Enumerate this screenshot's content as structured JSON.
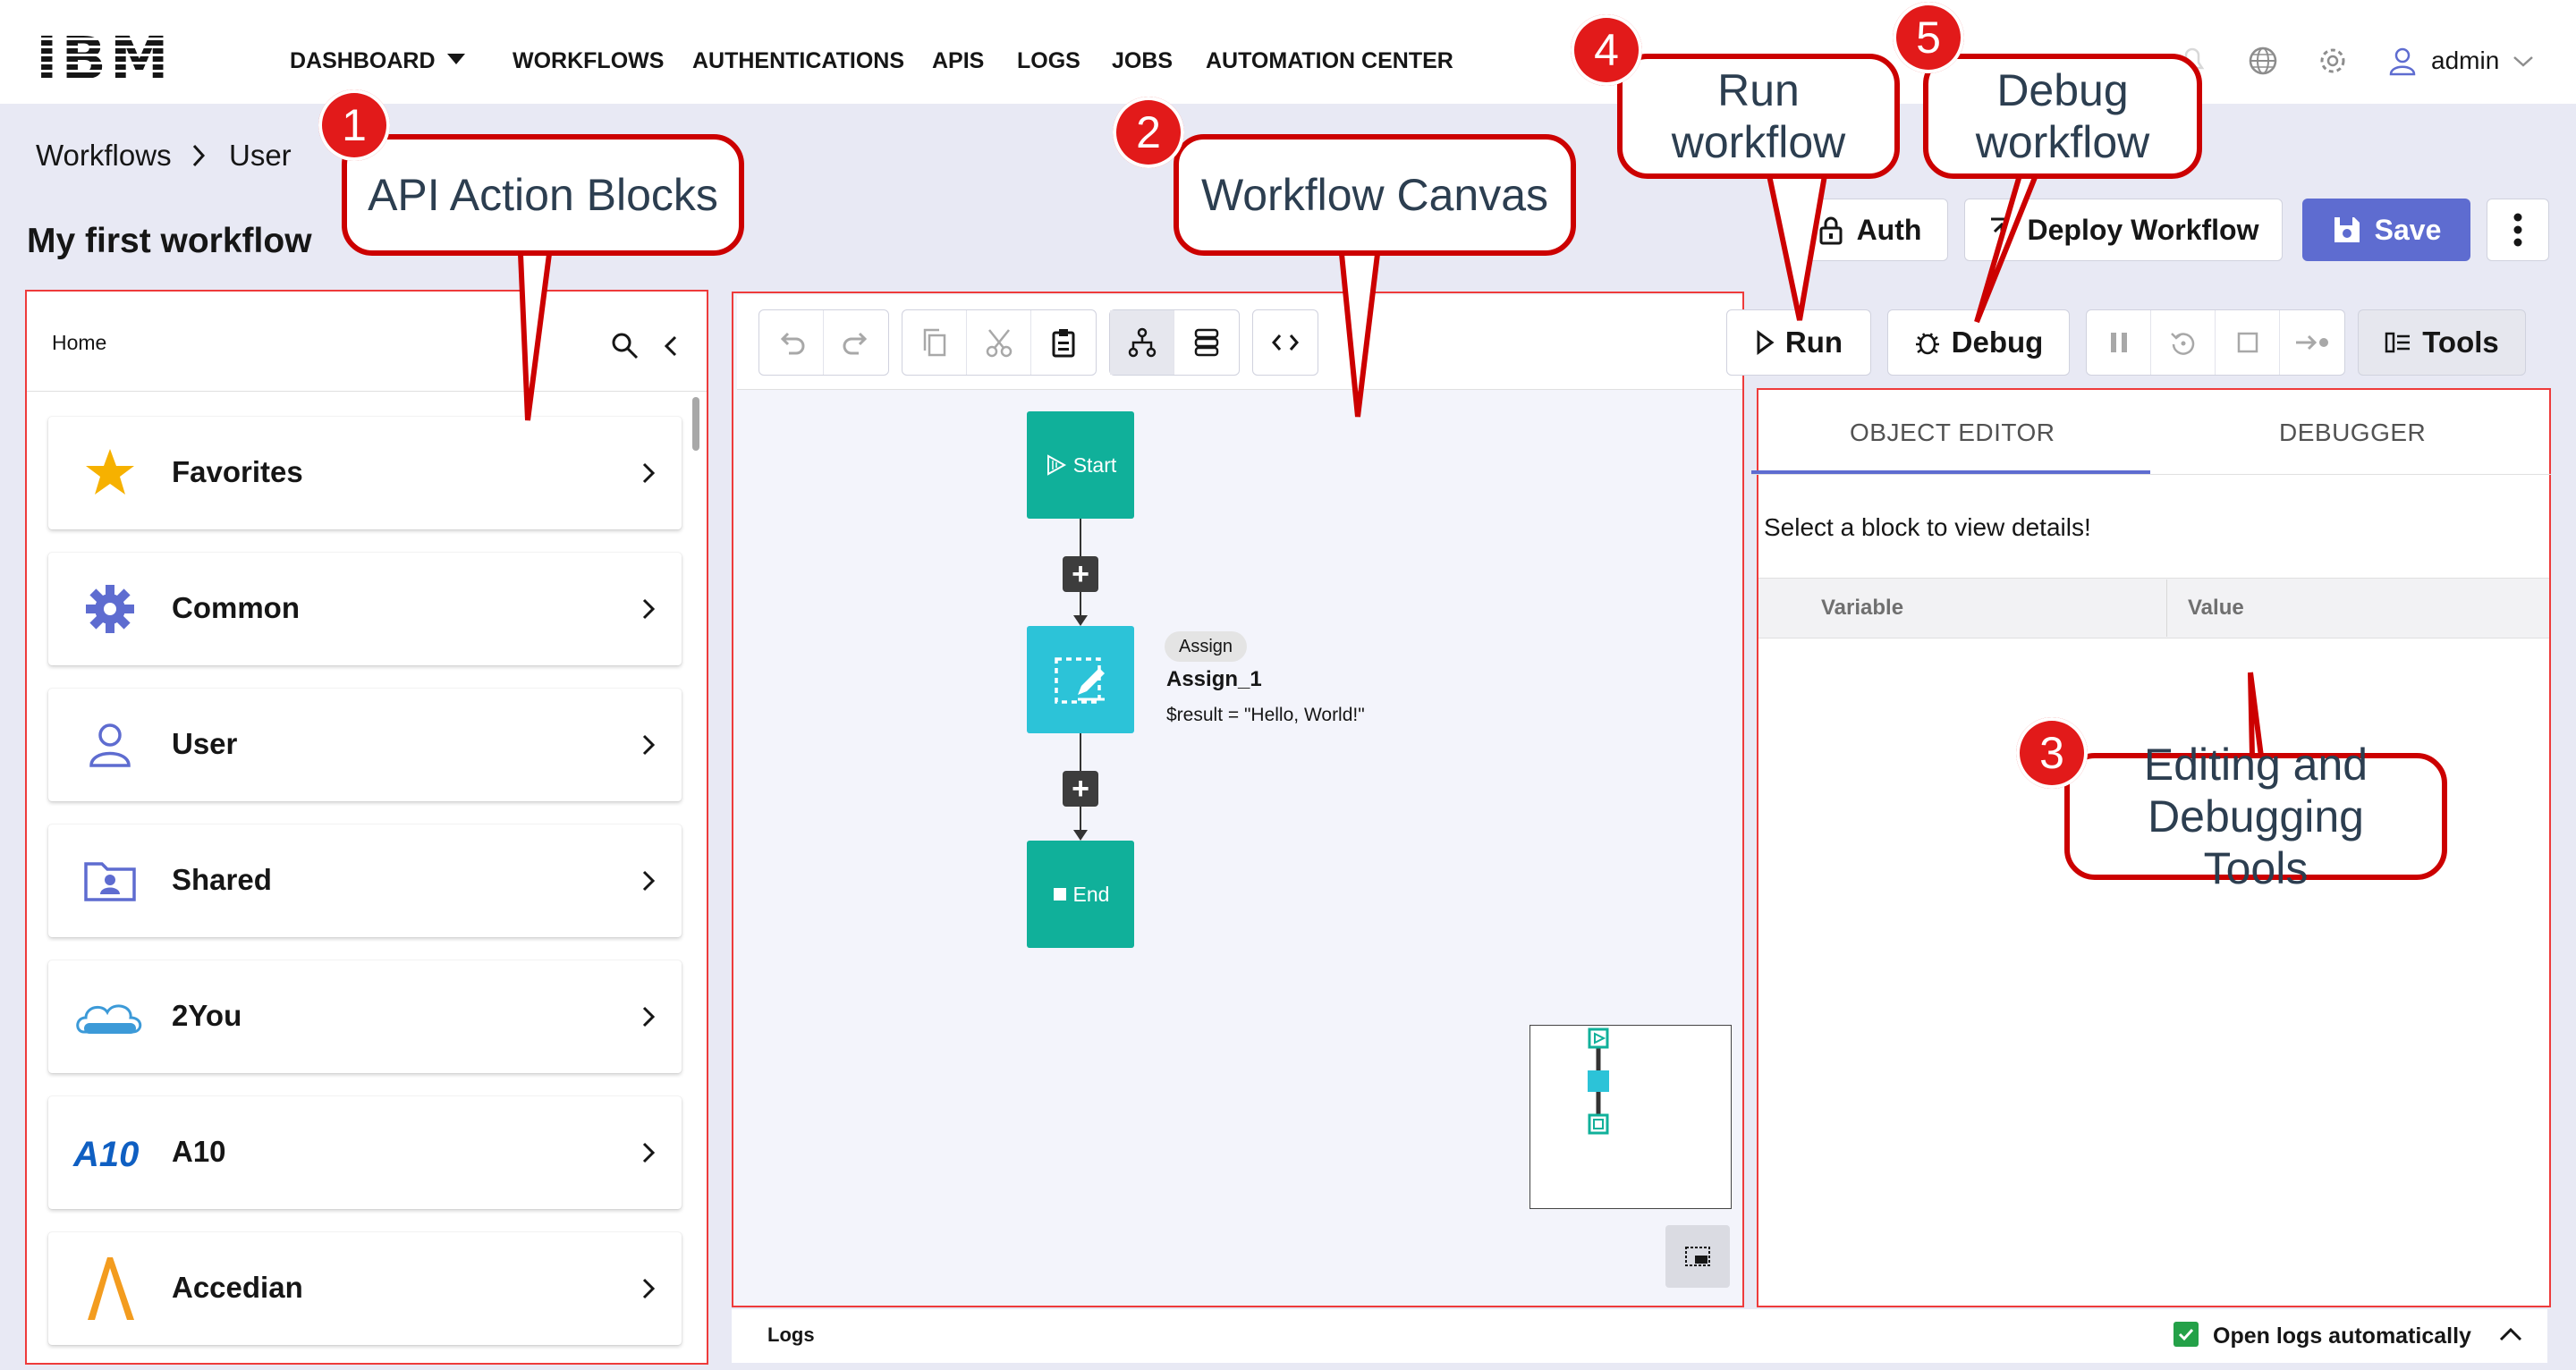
{
  "brand": {
    "logo": "IBM"
  },
  "nav": {
    "items": [
      "DASHBOARD",
      "WORKFLOWS",
      "AUTHENTICATIONS",
      "APIS",
      "LOGS",
      "JOBS",
      "AUTOMATION CENTER"
    ],
    "user": "admin"
  },
  "breadcrumb": {
    "root": "Workflows",
    "current": "User"
  },
  "page": {
    "title": "My first workflow"
  },
  "header_buttons": {
    "auth": "Auth",
    "deploy": "Deploy Workflow",
    "save": "Save"
  },
  "left_panel": {
    "home": "Home",
    "categories": [
      {
        "label": "Favorites",
        "icon": "star-icon"
      },
      {
        "label": "Common",
        "icon": "gear-icon"
      },
      {
        "label": "User",
        "icon": "user-icon"
      },
      {
        "label": "Shared",
        "icon": "shared-folder-icon"
      },
      {
        "label": "2You",
        "icon": "2you-logo-icon"
      },
      {
        "label": "A10",
        "icon": "a10-logo-icon"
      },
      {
        "label": "Accedian",
        "icon": "accedian-logo-icon"
      }
    ]
  },
  "canvas": {
    "start_label": "Start",
    "end_label": "End",
    "assign": {
      "tag": "Assign",
      "name": "Assign_1",
      "expr": "$result = \"Hello, World!\""
    }
  },
  "run_controls": {
    "run": "Run",
    "debug": "Debug",
    "tools": "Tools"
  },
  "right_panel": {
    "tabs": [
      "OBJECT EDITOR",
      "DEBUGGER"
    ],
    "active_tab": "OBJECT EDITOR",
    "message": "Select a block to view details!",
    "columns": [
      "Variable",
      "Value"
    ]
  },
  "logs": {
    "label": "Logs",
    "open_auto": "Open logs automatically",
    "open_auto_checked": true
  },
  "callouts": [
    {
      "num": "1",
      "text": "API Action Blocks"
    },
    {
      "num": "2",
      "text": "Workflow Canvas"
    },
    {
      "num": "3",
      "text": "Editing and Debugging Tools"
    },
    {
      "num": "4",
      "text": "Run workflow"
    },
    {
      "num": "5",
      "text": "Debug workflow"
    }
  ],
  "colors": {
    "accent": "#5e6cd0",
    "node_teal": "#10b09a",
    "assign_cyan": "#2cc3d8",
    "callout_red": "#cc0000",
    "highlight_red": "#ee3b3b"
  }
}
